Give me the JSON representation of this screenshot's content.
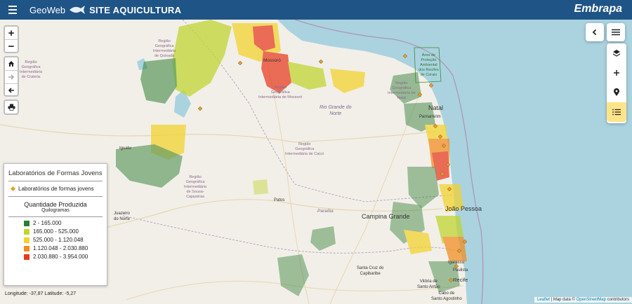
{
  "header": {
    "brand": "GeoWeb",
    "title": "SITE AQUICULTURA",
    "logo_text": "Embrapa",
    "bar_color": "#1f5486"
  },
  "controls": {
    "zoom_in": "+",
    "zoom_out": "−"
  },
  "legend": {
    "title": "Laboratórios de Formas Jovens",
    "lab_item": "Laboratórios de formas jovens",
    "quantity_title": "Quantidade Produzida",
    "unit": "Quilogramas",
    "classes": [
      {
        "label": "2 - 165.000",
        "color": "#2e7d32"
      },
      {
        "label": "165.000 - 525.000",
        "color": "#c0d52c"
      },
      {
        "label": "525.000 - 1.120.048",
        "color": "#f2d22a"
      },
      {
        "label": "1.120.048 - 2.030.880",
        "color": "#f28c1e"
      },
      {
        "label": "2.030.880 - 3.954.000",
        "color": "#e8391e"
      }
    ]
  },
  "status": {
    "coordinates": "Longitude: -37,87 Latitude: -5,27"
  },
  "attribution": {
    "leaflet": "Leaflet",
    "separator": " | Map data © ",
    "osm": "OpenStreetMap",
    "suffix": " contributors"
  },
  "map_labels": {
    "quixada": "Região\nGeográfica\nIntermediária\nde Quixadá",
    "crateus": "Região\nGeográfica\nIntermediária\nde Crateús",
    "mossoro_region": "Região\nGeográfica\nIntermediária de Mossoró",
    "natal_region": "Região\nGeográfica\nIntermediária de\nNatal",
    "caico": "Região\nGeográfica\nIntermediária de Caicó",
    "sousa": "Região\nGeográfica\nIntermediária\nde Sousa-\nCajazeiras",
    "area_protecao": "Área de\nProteção\nAmbiental\ndos Recifes\nde Corais",
    "rio_grande": "Rio Grande do\nNorte",
    "mossoro": "Mossoró",
    "natal": "Natal",
    "parnamirim": "Parnamirim",
    "iguatu": "Iguatu",
    "patos": "Patos",
    "paraiba": "Paraíba",
    "juazeiro": "Juazeiro\ndo Norte",
    "campina": "Campina Grande",
    "joao_pessoa": "João Pessoa",
    "santa_cruz": "Santa Cruz do\nCapibaribe",
    "igarassu": "Igarassu",
    "paulista": "Paulista",
    "recife": "Recife",
    "vitoria": "Vitória de\nSanto Antão",
    "cabo": "Cabo de\nSanto Agostinho"
  }
}
